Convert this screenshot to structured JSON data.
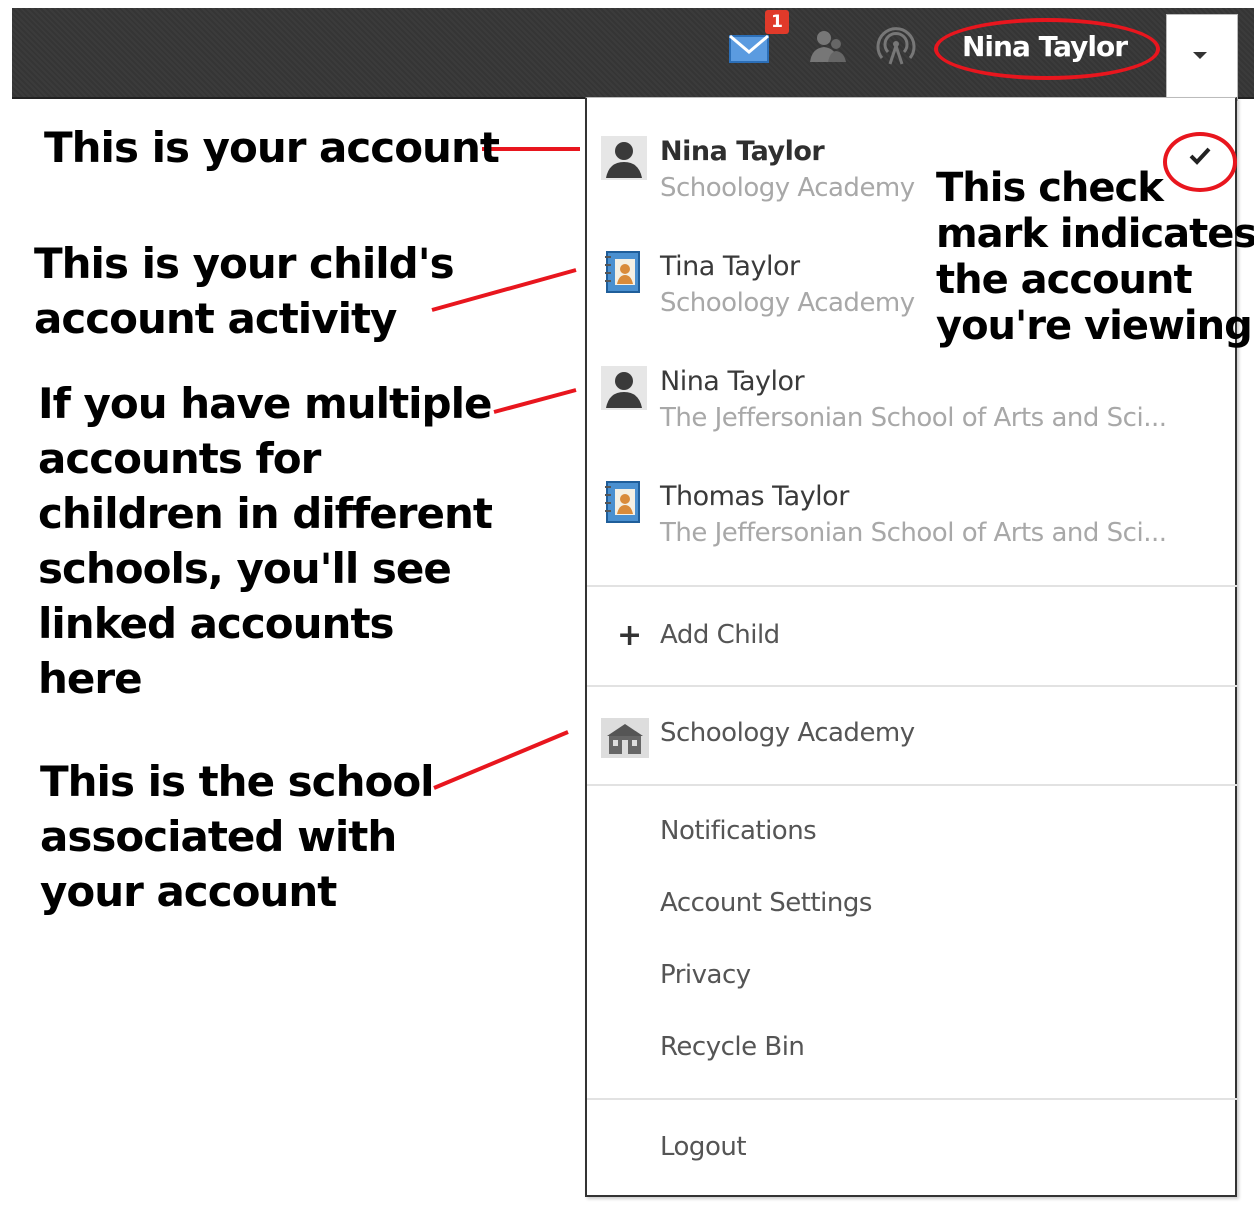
{
  "topbar": {
    "mail_badge": "1",
    "username": "Nina Taylor",
    "icons": [
      "mail-icon",
      "people-icon",
      "signal-icon",
      "caret-down-icon"
    ]
  },
  "accounts": [
    {
      "name": "Nina Taylor",
      "school": "Schoology Academy",
      "type": "parent",
      "selected": true
    },
    {
      "name": "Tina Taylor",
      "school": "Schoology Academy",
      "type": "child",
      "selected": false
    },
    {
      "name": "Nina Taylor",
      "school": "The Jeffersonian School of Arts and Sci...",
      "type": "parent",
      "selected": false
    },
    {
      "name": "Thomas Taylor",
      "school": "The Jeffersonian School of Arts and Sci...",
      "type": "child",
      "selected": false
    }
  ],
  "menu": {
    "add_child": "Add Child",
    "school": "Schoology Academy",
    "notifications": "Notifications",
    "account_settings": "Account Settings",
    "privacy": "Privacy",
    "recycle_bin": "Recycle Bin",
    "logout": "Logout"
  },
  "annotations": {
    "your_account": "This is your account",
    "child_activity": [
      "This is your child's",
      "account activity"
    ],
    "multiple": [
      "If you have multiple",
      "accounts for",
      "children in different",
      "schools, you'll see",
      "linked accounts",
      "here"
    ],
    "school": [
      "This is the school",
      "associated with",
      "your account"
    ],
    "check_mark": [
      "This check",
      "mark indicates",
      "the account",
      "you're viewing"
    ]
  },
  "colors": {
    "annotation_red": "#e8161e",
    "topbar_bg": "#3a3a3a"
  }
}
